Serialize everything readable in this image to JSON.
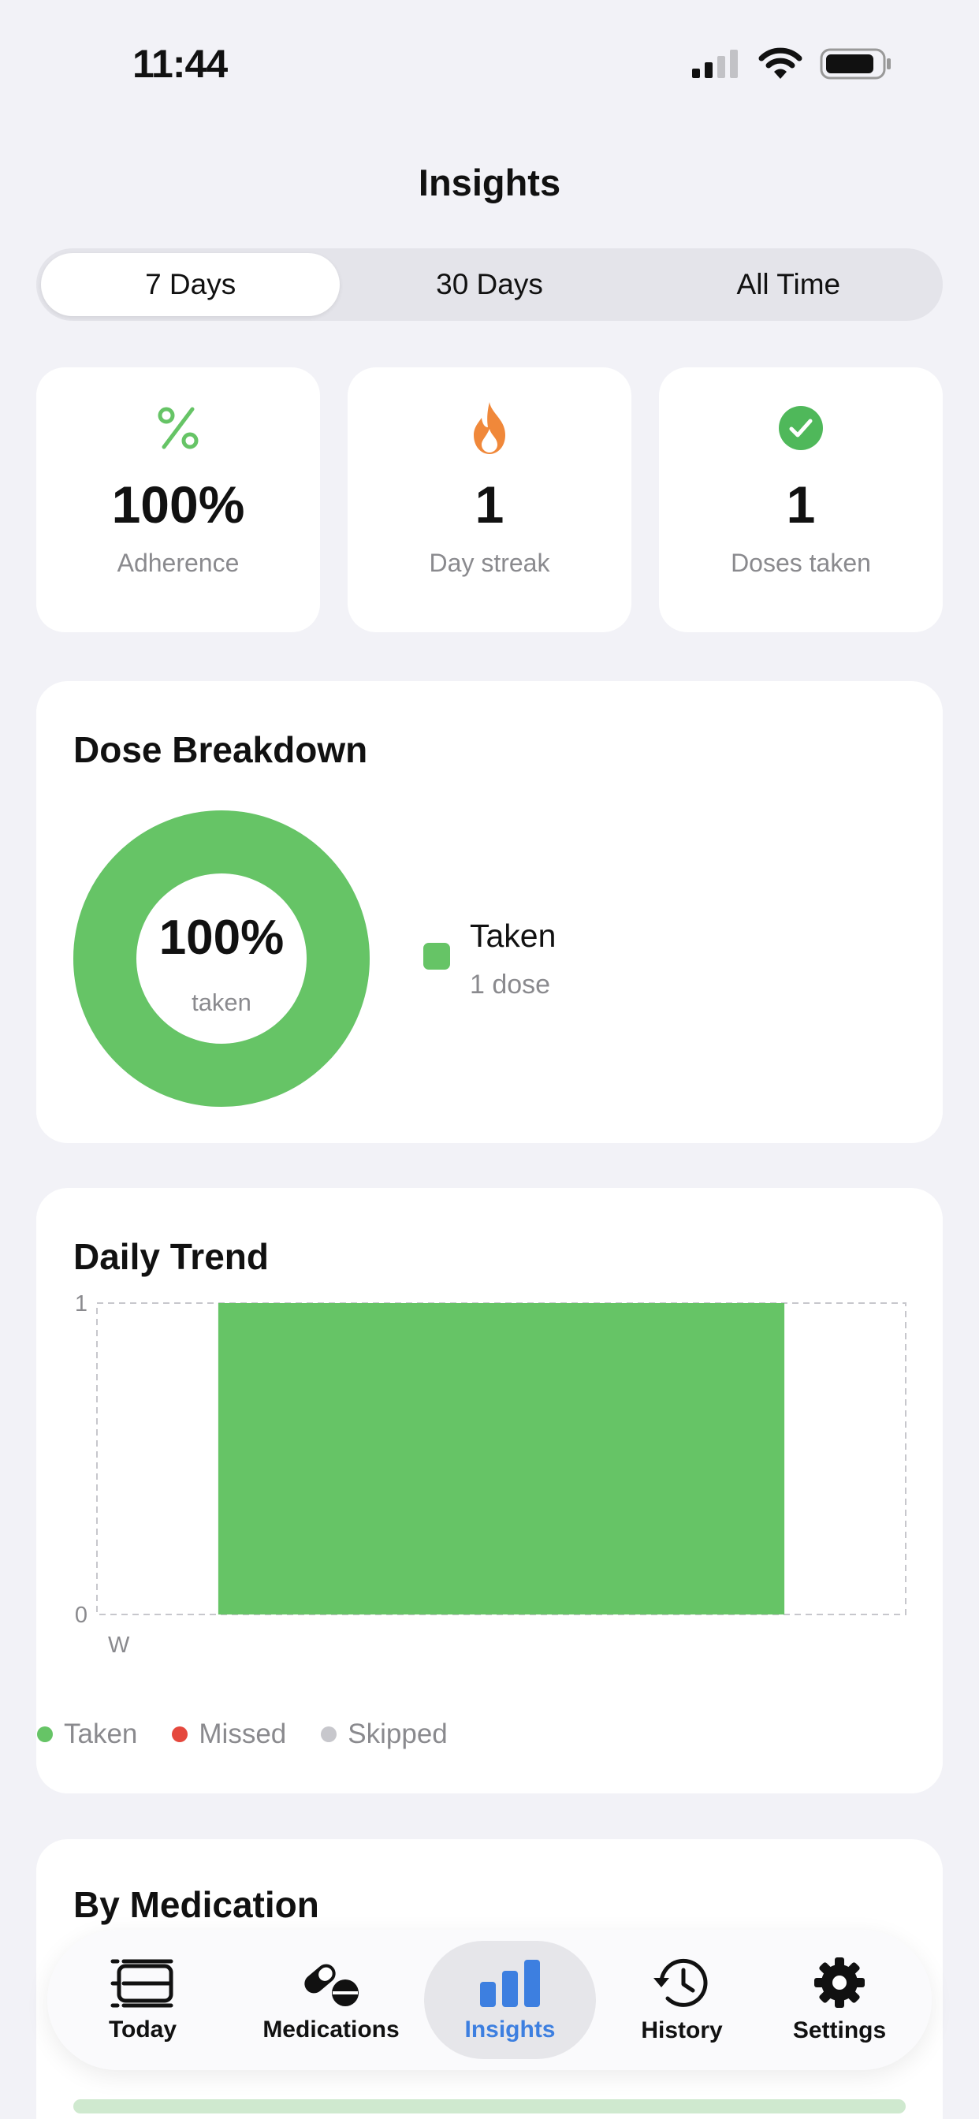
{
  "status": {
    "time": "11:44"
  },
  "header": {
    "title": "Insights"
  },
  "range_tabs": [
    {
      "label": "7 Days",
      "active": true
    },
    {
      "label": "30 Days",
      "active": false
    },
    {
      "label": "All Time",
      "active": false
    }
  ],
  "stats": [
    {
      "icon": "percent-icon",
      "value": "100%",
      "label": "Adherence"
    },
    {
      "icon": "flame-icon",
      "value": "1",
      "label": "Day streak"
    },
    {
      "icon": "checkmark-circle-icon",
      "value": "1",
      "label": "Doses taken"
    }
  ],
  "dose_breakdown": {
    "title": "Dose Breakdown",
    "center_value": "100%",
    "center_label": "taken",
    "taken_fraction": 1.0,
    "legend": [
      {
        "label": "Taken",
        "detail": "1 dose",
        "color": "#66c466"
      }
    ]
  },
  "daily_trend": {
    "title": "Daily Trend",
    "chart_data": {
      "type": "bar",
      "categories": [
        "W"
      ],
      "series": [
        {
          "name": "Taken",
          "values": [
            1
          ],
          "color": "#66c466"
        },
        {
          "name": "Missed",
          "values": [
            0
          ],
          "color": "#e5483d"
        },
        {
          "name": "Skipped",
          "values": [
            0
          ],
          "color": "#c7c7cc"
        }
      ],
      "ylim": [
        0,
        1
      ],
      "yticks": [
        "1",
        "0"
      ]
    },
    "legend": [
      {
        "label": "Taken",
        "color": "#66c466"
      },
      {
        "label": "Missed",
        "color": "#e5483d"
      },
      {
        "label": "Skipped",
        "color": "#c7c7cc"
      }
    ]
  },
  "by_medication": {
    "title": "By Medication"
  },
  "colors": {
    "accent": "#3d7fe0",
    "taken": "#66c466",
    "streak": "#f0883a"
  },
  "tab_bar": [
    {
      "label": "Today",
      "icon": "today-list-icon",
      "active": false
    },
    {
      "label": "Medications",
      "icon": "pills-icon",
      "active": false
    },
    {
      "label": "Insights",
      "icon": "bar-chart-icon",
      "active": true
    },
    {
      "label": "History",
      "icon": "history-clock-icon",
      "active": false
    },
    {
      "label": "Settings",
      "icon": "gear-icon",
      "active": false
    }
  ]
}
